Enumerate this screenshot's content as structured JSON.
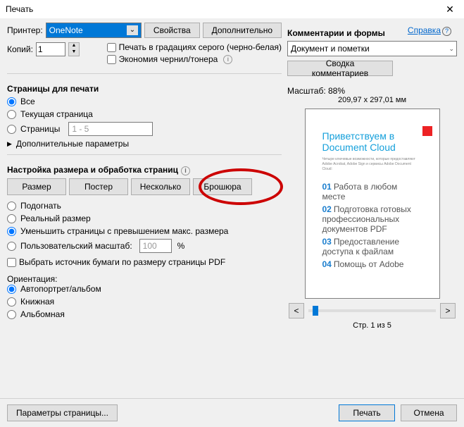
{
  "title": "Печать",
  "printer": {
    "label": "Принтер:",
    "value": "OneNote",
    "properties": "Свойства",
    "advanced": "Дополнительно"
  },
  "copies": {
    "label": "Копий:",
    "value": "1"
  },
  "help": "Справка",
  "opts": {
    "grayscale": "Печать в градациях серого (черно-белая)",
    "ink": "Экономия чернил/тонера"
  },
  "pages": {
    "title": "Страницы для печати",
    "all": "Все",
    "current": "Текущая страница",
    "range": "Страницы",
    "range_ph": "1 - 5",
    "more": "Дополнительные параметры"
  },
  "sizing": {
    "title": "Настройка размера и обработка страниц",
    "t1": "Размер",
    "t2": "Постер",
    "t3": "Несколько",
    "t4": "Брошюра",
    "fit": "Подогнать",
    "actual": "Реальный размер",
    "shrink": "Уменьшить страницы с превышением макс. размера",
    "custom": "Пользовательский масштаб:",
    "custom_val": "100",
    "pct": "%",
    "choose": "Выбрать источник бумаги по размеру страницы PDF"
  },
  "orient": {
    "title": "Ориентация:",
    "auto": "Автопортрет/альбом",
    "portrait": "Книжная",
    "landscape": "Альбомная"
  },
  "comments": {
    "title": "Комментарии и формы",
    "sel": "Документ и пометки",
    "summary": "Сводка комментариев"
  },
  "preview": {
    "scale": "Масштаб:  88%",
    "paper": "209,97 x 297,01 мм",
    "h": "Приветствуем в Document Cloud",
    "sub": "Четыре ключевые возможности, которые предоставляют Adobe Acrobat, Adobe Sign и сервисы Adobe Document Cloud:",
    "i1": "Работа в любом месте",
    "i2": "Подготовка готовых профессиональных документов PDF",
    "i3": "Предоставление доступа к файлам",
    "i4": "Помощь от Adobe",
    "page": "Стр. 1 из 5"
  },
  "pagesetup": "Параметры страницы...",
  "print": "Печать",
  "cancel": "Отмена"
}
